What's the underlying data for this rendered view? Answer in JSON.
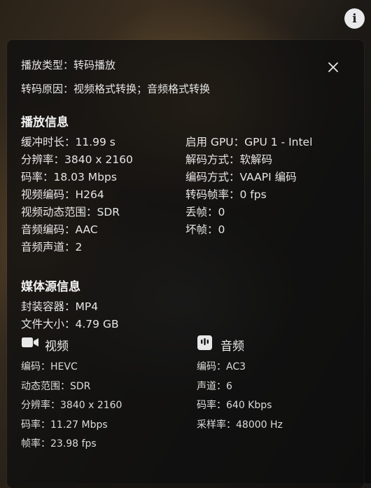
{
  "top": {
    "play_type": "播放类型：转码播放",
    "transcode_reason": "转码原因：视频格式转换；音频格式转换"
  },
  "playback": {
    "title": "播放信息",
    "left": [
      "缓冲时长：11.99 s",
      "分辨率：3840 x 2160",
      "码率：18.03 Mbps",
      "视频编码：H264",
      "视频动态范围：SDR",
      "音频编码：AAC",
      "音频声道：2"
    ],
    "right": [
      "启用 GPU：GPU 1 - Intel",
      "解码方式：软解码",
      "编码方式：VAAPI 编码",
      "转码帧率：0 fps",
      "丢帧：0",
      "坏帧：0"
    ]
  },
  "media": {
    "title": "媒体源信息",
    "container": "封装容器：MP4",
    "file_size": "文件大小：4.79 GB",
    "video": {
      "header": "视频",
      "rows": [
        "编码：HEVC",
        "动态范围：SDR",
        "分辨率：3840 x 2160",
        "码率：11.27 Mbps",
        "帧率：23.98 fps"
      ]
    },
    "audio": {
      "header": "音频",
      "rows": [
        "编码：AC3",
        "声道：6",
        "码率：640 Kbps",
        "采样率：48000 Hz"
      ]
    }
  },
  "icons": {
    "info": "info-icon",
    "close": "close-icon",
    "video": "video-camera-icon",
    "audio": "audio-icon"
  }
}
